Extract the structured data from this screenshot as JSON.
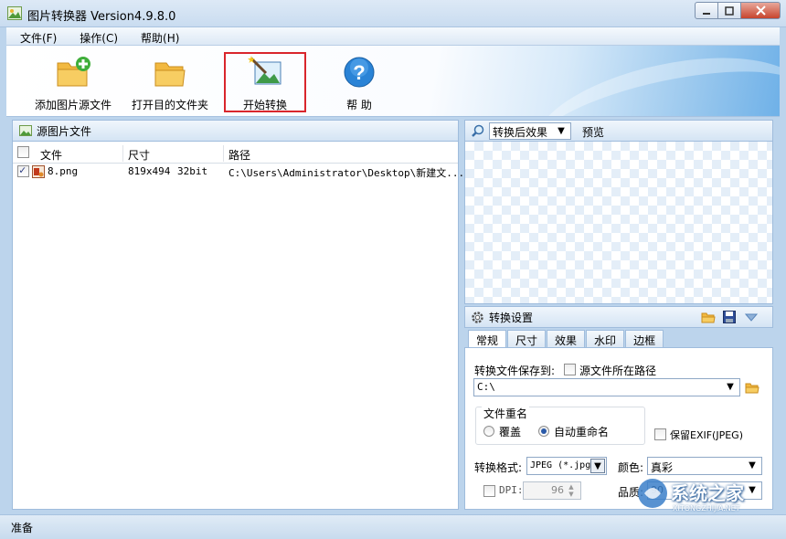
{
  "window": {
    "title": "图片转换器 Version4.9.8.0"
  },
  "menu": [
    {
      "label": "文件(F)"
    },
    {
      "label": "操作(C)"
    },
    {
      "label": "帮助(H)"
    }
  ],
  "toolbar": {
    "add_source": "添加图片源文件",
    "open_dest": "打开目的文件夹",
    "start": "开始转换",
    "help": "帮 助"
  },
  "source_panel": {
    "title": "源图片文件",
    "columns": {
      "file": "文件",
      "size": "尺寸",
      "path": "路径"
    },
    "rows": [
      {
        "checked": true,
        "file": "8.png",
        "dims": "819x494",
        "depth": "32bit",
        "path": "C:\\Users\\Administrator\\Desktop\\新建文..."
      }
    ]
  },
  "preview_panel": {
    "mode": "转换后效果",
    "label": "预览"
  },
  "settings": {
    "title": "转换设置",
    "tabs": [
      "常规",
      "尺寸",
      "效果",
      "水印",
      "边框"
    ],
    "save_to_label": "转换文件保存到:",
    "source_path_label": "源文件所在路径",
    "save_path": "C:\\",
    "rename_group": "文件重名",
    "overwrite": "覆盖",
    "auto_rename": "自动重命名",
    "keep_exif": "保留EXIF(JPEG)",
    "format_label": "转换格式:",
    "format_value": "JPEG (*.jpg",
    "color_label": "颜色:",
    "color_value": "真彩",
    "dpi_label": "DPI:",
    "dpi_value": "96",
    "quality_label": "品质:",
    "quality_value": "90"
  },
  "status": {
    "text": "准备"
  },
  "watermark": {
    "brand": "系统之家",
    "domain": "XITONGZHIJIA.NET"
  },
  "colors": {
    "highlight_border": "#d9262c",
    "accent_blue": "#2b5aa8"
  }
}
